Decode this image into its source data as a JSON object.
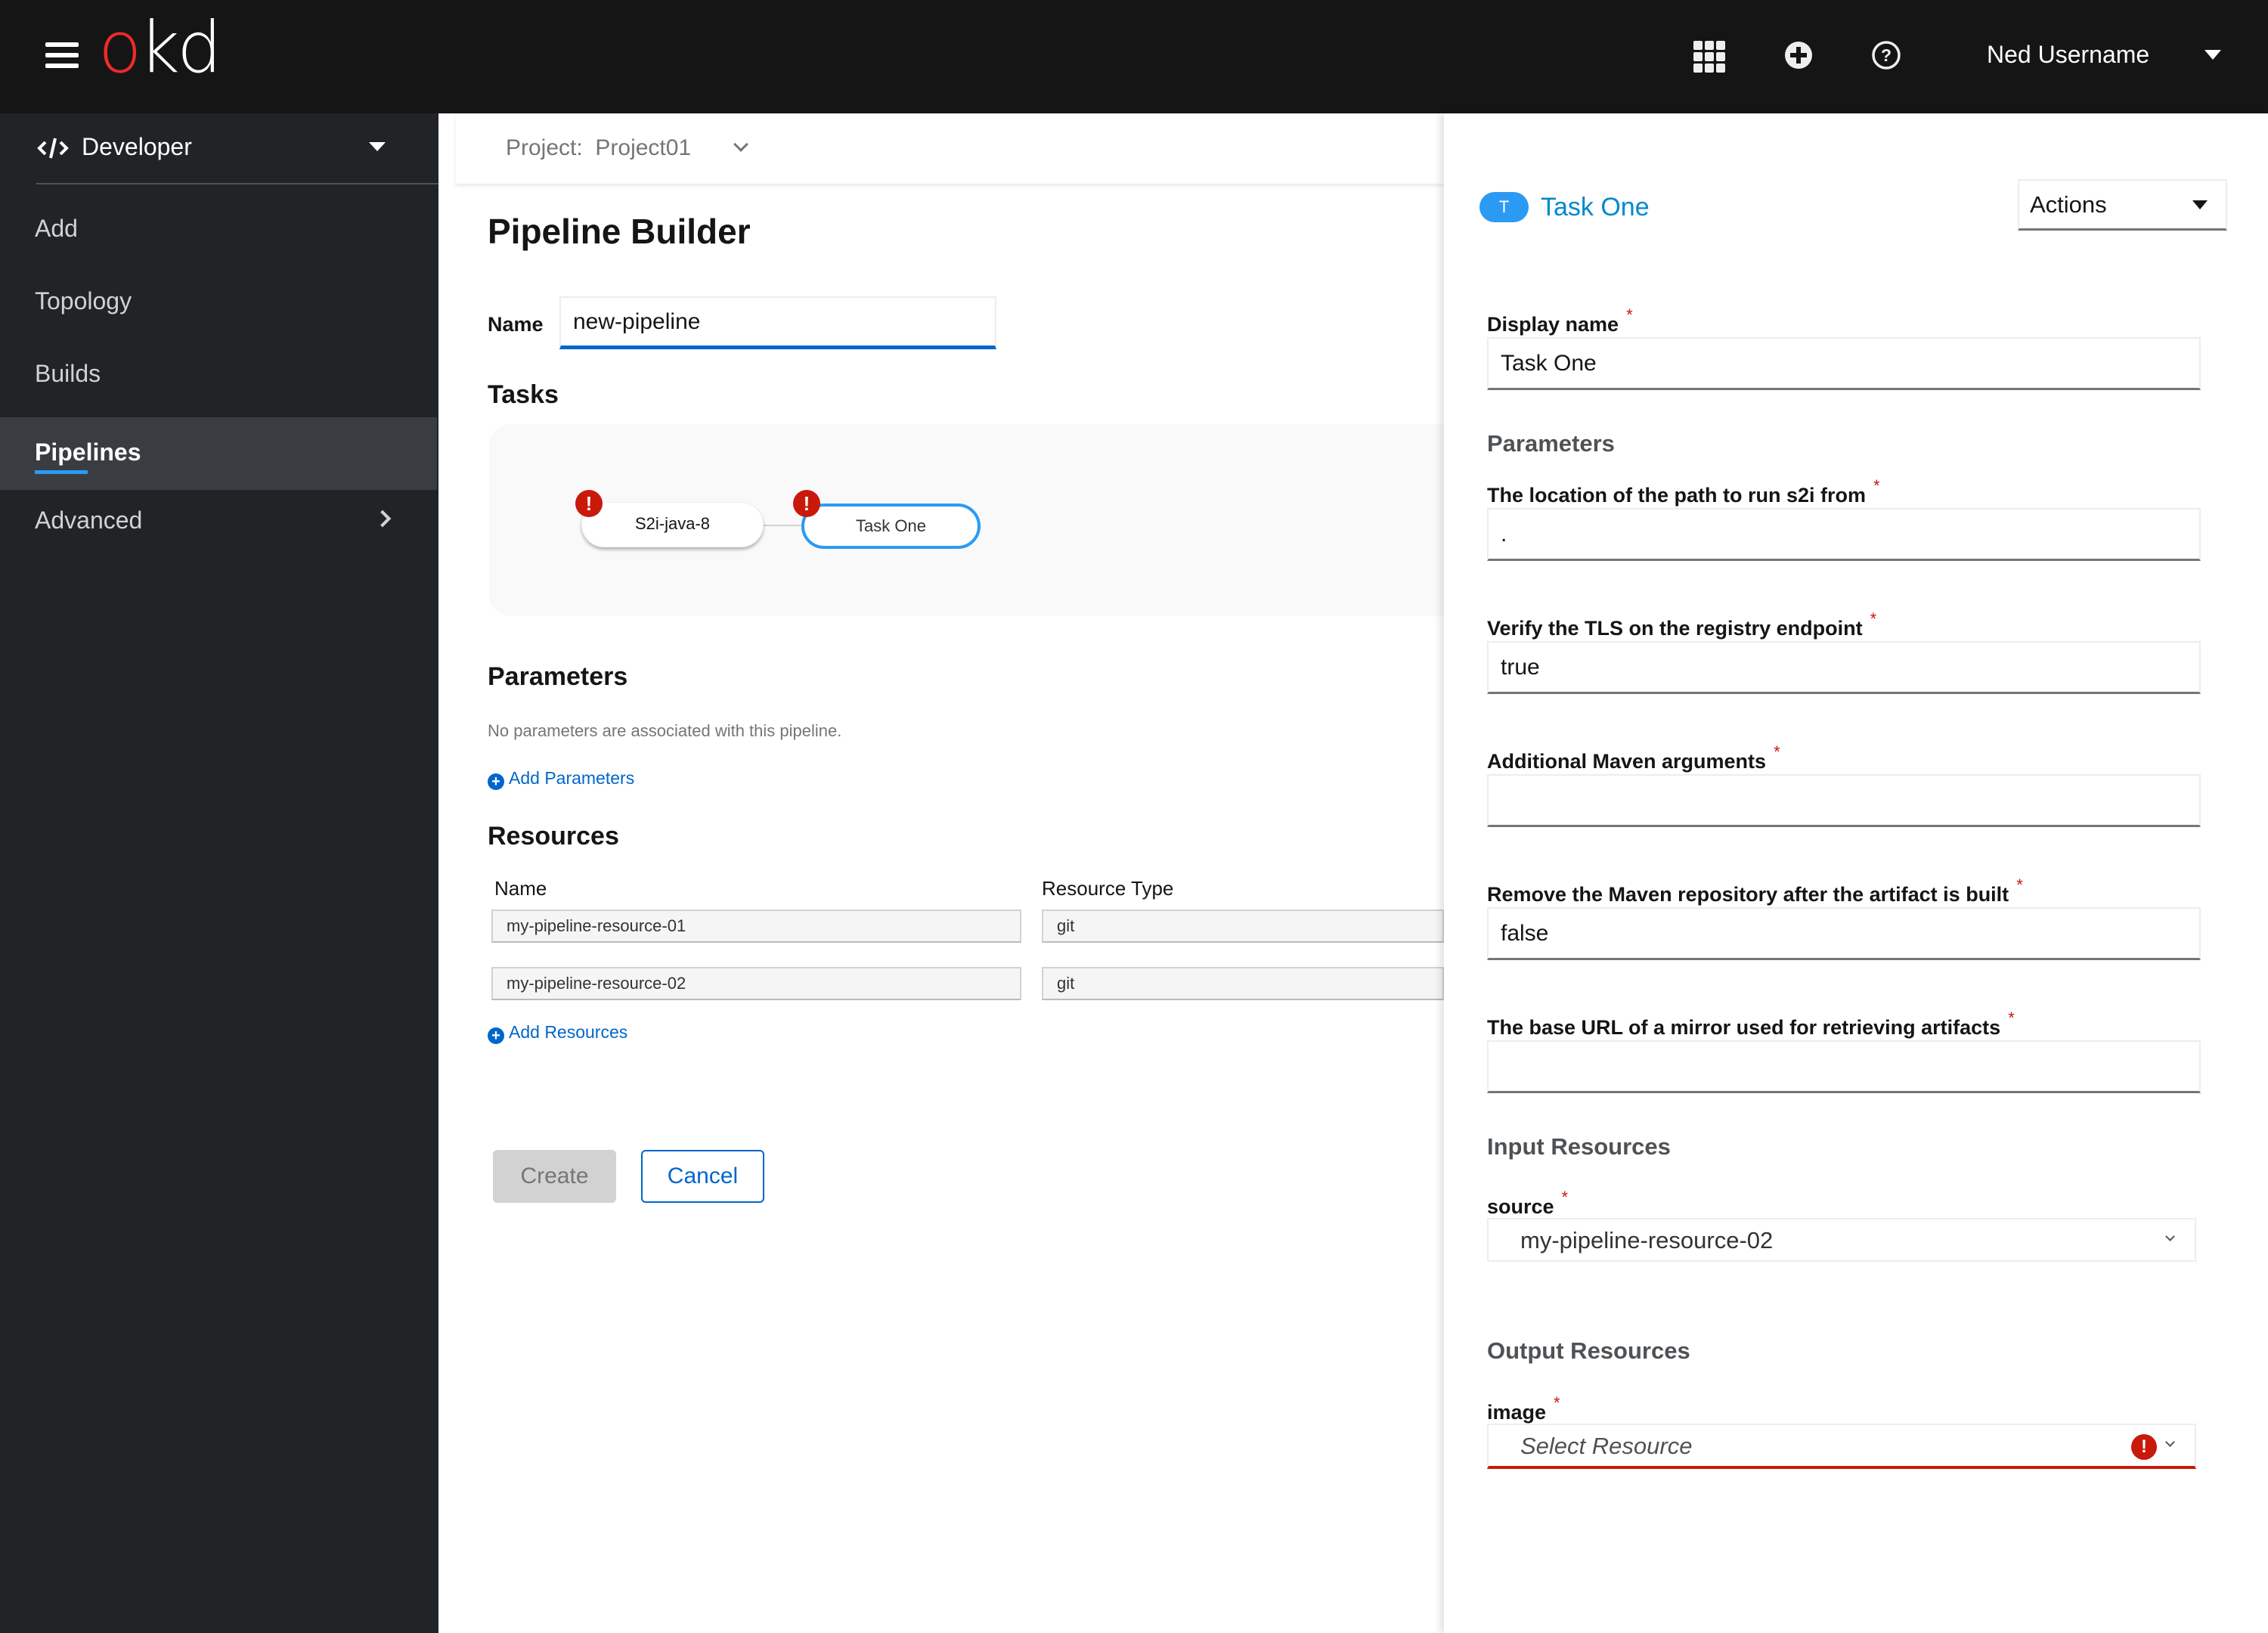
{
  "masthead": {
    "logo_prefix": "o",
    "logo_suffix": "kd",
    "user_name": "Ned Username",
    "icons": [
      "menu-icon",
      "app-launcher-icon",
      "add-icon",
      "help-icon",
      "caret-down-icon"
    ]
  },
  "sidebar": {
    "perspective": "Developer",
    "items": [
      {
        "label": "Add",
        "active": false
      },
      {
        "label": "Topology",
        "active": false
      },
      {
        "label": "Builds",
        "active": false
      },
      {
        "label": "Pipelines",
        "active": true
      },
      {
        "label": "Advanced",
        "active": false,
        "expandable": true
      }
    ]
  },
  "project_bar": {
    "label": "Project:",
    "value": "Project01"
  },
  "builder": {
    "title": "Pipeline Builder",
    "name_label": "Name",
    "name_value": "new-pipeline",
    "tasks_heading": "Tasks",
    "tasks": [
      {
        "name": "S2i-java-8",
        "has_error": true,
        "selected": false
      },
      {
        "name": "Task One",
        "has_error": true,
        "selected": true
      }
    ],
    "parameters_heading": "Parameters",
    "parameters_empty": "No parameters are associated with this pipeline.",
    "add_parameters": "Add Parameters",
    "resources_heading": "Resources",
    "resource_columns": [
      "Name",
      "Resource Type"
    ],
    "resources": [
      {
        "name": "my-pipeline-resource-01",
        "type": "git"
      },
      {
        "name": "my-pipeline-resource-02",
        "type": "git"
      }
    ],
    "add_resources": "Add Resources",
    "create_label": "Create",
    "cancel_label": "Cancel"
  },
  "panel": {
    "badge": "T",
    "title": "Task One",
    "actions_label": "Actions",
    "display_name_label": "Display name",
    "display_name_value": "Task One",
    "parameters_heading": "Parameters",
    "parameters": [
      {
        "label": "The location of the path to run s2i from",
        "value": ".",
        "required": true
      },
      {
        "label": "Verify the TLS on the registry endpoint",
        "value": "true",
        "required": true
      },
      {
        "label": "Additional Maven arguments",
        "value": "",
        "required": true
      },
      {
        "label": "Remove the Maven repository after the artifact is built",
        "value": "false",
        "required": true
      },
      {
        "label": "The base URL of a mirror used for retrieving artifacts",
        "value": "",
        "required": true
      }
    ],
    "input_resources_heading": "Input Resources",
    "input_resource": {
      "label": "source",
      "value": "my-pipeline-resource-02",
      "required": true
    },
    "output_resources_heading": "Output Resources",
    "output_resource": {
      "label": "image",
      "placeholder": "Select Resource",
      "required": true,
      "has_error": true
    },
    "required_marker": "*"
  },
  "colors": {
    "masthead_bg": "#151515",
    "sidebar_bg": "#212427",
    "sidebar_active_bg": "#393d41",
    "accent_blue": "#2b9af3",
    "link_blue": "#0066cc",
    "error_red": "#c9190b",
    "logo_red": "#ee2a2a"
  }
}
